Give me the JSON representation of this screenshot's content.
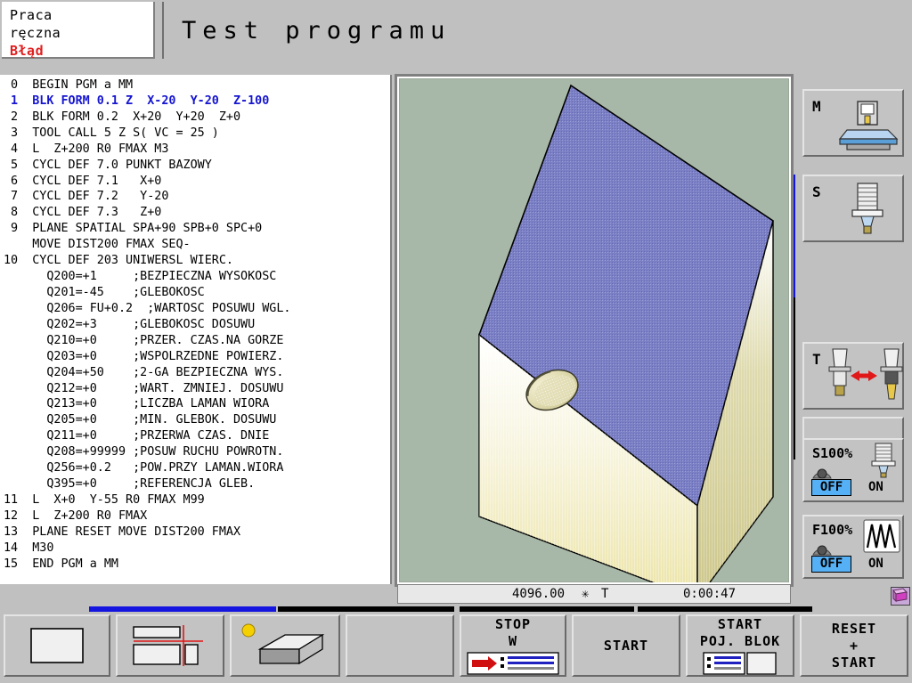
{
  "header": {
    "mode_line1": "Praca",
    "mode_line2": "ręczna",
    "error_label": "Błąd",
    "title": "Test programu"
  },
  "program": {
    "lines": [
      {
        "num": "0",
        "text": "BEGIN PGM a MM",
        "highlight": false
      },
      {
        "num": "1",
        "text": "BLK FORM 0.1 Z  X-20  Y-20  Z-100",
        "highlight": true
      },
      {
        "num": "2",
        "text": "BLK FORM 0.2  X+20  Y+20  Z+0",
        "highlight": false
      },
      {
        "num": "3",
        "text": "TOOL CALL 5 Z S( VC = 25 )",
        "highlight": false
      },
      {
        "num": "4",
        "text": "L  Z+200 R0 FMAX M3",
        "highlight": false
      },
      {
        "num": "5",
        "text": "CYCL DEF 7.0 PUNKT BAZOWY",
        "highlight": false
      },
      {
        "num": "6",
        "text": "CYCL DEF 7.1   X+0",
        "highlight": false
      },
      {
        "num": "7",
        "text": "CYCL DEF 7.2   Y-20",
        "highlight": false
      },
      {
        "num": "8",
        "text": "CYCL DEF 7.3   Z+0",
        "highlight": false
      },
      {
        "num": "9",
        "text": "PLANE SPATIAL SPA+90 SPB+0 SPC+0",
        "highlight": false
      },
      {
        "num": "",
        "text": "MOVE DIST200 FMAX SEQ-",
        "highlight": false
      },
      {
        "num": "10",
        "text": "CYCL DEF 203 UNIWERSL WIERC.",
        "highlight": false
      },
      {
        "num": "",
        "text": "  Q200=+1     ;BEZPIECZNA WYSOKOSC",
        "highlight": false
      },
      {
        "num": "",
        "text": "  Q201=-45    ;GLEBOKOSC",
        "highlight": false
      },
      {
        "num": "",
        "text": "  Q206= FU+0.2  ;WARTOSC POSUWU WGL.",
        "highlight": false
      },
      {
        "num": "",
        "text": "  Q202=+3     ;GLEBOKOSC DOSUWU",
        "highlight": false
      },
      {
        "num": "",
        "text": "  Q210=+0     ;PRZER. CZAS.NA GORZE",
        "highlight": false
      },
      {
        "num": "",
        "text": "  Q203=+0     ;WSPOLRZEDNE POWIERZ.",
        "highlight": false
      },
      {
        "num": "",
        "text": "  Q204=+50    ;2-GA BEZPIECZNA WYS.",
        "highlight": false
      },
      {
        "num": "",
        "text": "  Q212=+0     ;WART. ZMNIEJ. DOSUWU",
        "highlight": false
      },
      {
        "num": "",
        "text": "  Q213=+0     ;LICZBA LAMAN WIORA",
        "highlight": false
      },
      {
        "num": "",
        "text": "  Q205=+0     ;MIN. GLEBOK. DOSUWU",
        "highlight": false
      },
      {
        "num": "",
        "text": "  Q211=+0     ;PRZERWA CZAS. DNIE",
        "highlight": false
      },
      {
        "num": "",
        "text": "  Q208=+99999 ;POSUW RUCHU POWROTN.",
        "highlight": false
      },
      {
        "num": "",
        "text": "  Q256=+0.2   ;POW.PRZY LAMAN.WIORA",
        "highlight": false
      },
      {
        "num": "",
        "text": "  Q395=+0     ;REFERENCJA GLEB.",
        "highlight": false
      },
      {
        "num": "11",
        "text": "L  X+0  Y-55 R0 FMAX M99",
        "highlight": false
      },
      {
        "num": "12",
        "text": "L  Z+200 R0 FMAX",
        "highlight": false
      },
      {
        "num": "13",
        "text": "PLANE RESET MOVE DIST200 FMAX",
        "highlight": false
      },
      {
        "num": "14",
        "text": "M30",
        "highlight": false
      },
      {
        "num": "15",
        "text": "END PGM a MM",
        "highlight": false
      }
    ]
  },
  "graphics": {
    "background_color": "#a8b8a8",
    "top_face_color": "#7b7fc4",
    "side_light_color": "#f2f0dc",
    "side_dark_color": "#cfcb96"
  },
  "statusbar": {
    "value": "4096.00",
    "star": "✳",
    "axis": "T",
    "time": "0:00:47"
  },
  "sidebar": {
    "keys": [
      {
        "letter": "M",
        "icon": "machine-table-icon"
      },
      {
        "letter": "S",
        "icon": "spindle-tool-icon"
      },
      {
        "letter": "T",
        "icon": "tool-change-icon"
      },
      {
        "letter": "",
        "icon": "blank-icon"
      }
    ],
    "overrides": [
      {
        "label": "S100%",
        "off": "OFF",
        "on": "ON",
        "icon": "spindle-icon",
        "active": "OFF"
      },
      {
        "label": "F100%",
        "off": "OFF",
        "on": "ON",
        "icon": "feed-wave-icon",
        "active": "OFF"
      }
    ],
    "book_icon": "notebook-icon",
    "accent_color": "#1515e0"
  },
  "bottombar": {
    "progress_color": "#1515e0",
    "keys": [
      {
        "label": "",
        "label2": "",
        "label3": "",
        "icon": "single-window-icon"
      },
      {
        "label": "",
        "label2": "",
        "label3": "",
        "icon": "split-window-icon"
      },
      {
        "label": "",
        "label2": "",
        "label3": "",
        "icon": "solid-block-icon"
      },
      {
        "label": "",
        "label2": "",
        "label3": "",
        "icon": "blank-icon"
      },
      {
        "label": "STOP",
        "label2": "W",
        "label3": "",
        "icon": "stop-block-icon"
      },
      {
        "label": "START",
        "label2": "",
        "label3": "",
        "icon": "none"
      },
      {
        "label": "START",
        "label2": "POJ. BLOK",
        "label3": "",
        "icon": "single-block-icon"
      },
      {
        "label": "RESET",
        "label2": "+",
        "label3": "START",
        "icon": "none"
      }
    ]
  }
}
